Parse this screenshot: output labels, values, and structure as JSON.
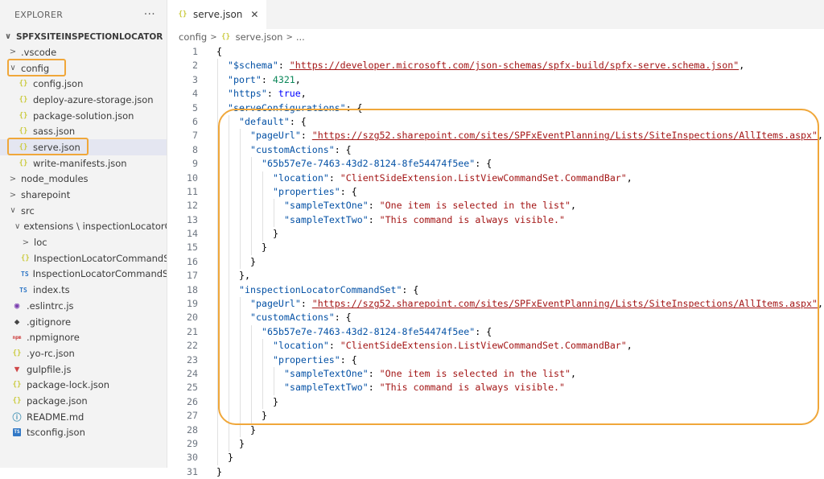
{
  "explorer": {
    "title": "EXPLORER",
    "more": "···",
    "root": "SPFXSITEINSPECTIONLOCATOR",
    "items": [
      {
        "label": ".vscode",
        "indent": 1,
        "chevron": ">",
        "icon": ""
      },
      {
        "label": "config",
        "indent": 1,
        "chevron": "∨",
        "icon": ""
      },
      {
        "label": "config.json",
        "indent": 2,
        "chevron": "",
        "icon": "{}"
      },
      {
        "label": "deploy-azure-storage.json",
        "indent": 2,
        "chevron": "",
        "icon": "{}"
      },
      {
        "label": "package-solution.json",
        "indent": 2,
        "chevron": "",
        "icon": "{}"
      },
      {
        "label": "sass.json",
        "indent": 2,
        "chevron": "",
        "icon": "{}"
      },
      {
        "label": "serve.json",
        "indent": 2,
        "chevron": "",
        "icon": "{}"
      },
      {
        "label": "write-manifests.json",
        "indent": 2,
        "chevron": "",
        "icon": "{}"
      },
      {
        "label": "node_modules",
        "indent": 1,
        "chevron": ">",
        "icon": ""
      },
      {
        "label": "sharepoint",
        "indent": 1,
        "chevron": ">",
        "icon": ""
      },
      {
        "label": "src",
        "indent": 1,
        "chevron": "∨",
        "icon": ""
      },
      {
        "label": "extensions \\ inspectionLocatorC...",
        "indent": 2,
        "chevron": "∨",
        "icon": ""
      },
      {
        "label": "loc",
        "indent": 3,
        "chevron": ">",
        "icon": ""
      },
      {
        "label": "InspectionLocatorCommandS...",
        "indent": 3,
        "chevron": "",
        "icon": "{}"
      },
      {
        "label": "InspectionLocatorCommandS...",
        "indent": 3,
        "chevron": "",
        "icon": "TS"
      },
      {
        "label": "index.ts",
        "indent": 2,
        "chevron": "",
        "icon": "TS"
      },
      {
        "label": ".eslintrc.js",
        "indent": 1,
        "chevron": "",
        "icon": "◉"
      },
      {
        "label": ".gitignore",
        "indent": 1,
        "chevron": "",
        "icon": "◆"
      },
      {
        "label": ".npmignore",
        "indent": 1,
        "chevron": "",
        "icon": "npm"
      },
      {
        "label": ".yo-rc.json",
        "indent": 1,
        "chevron": "",
        "icon": "{}"
      },
      {
        "label": "gulpfile.js",
        "indent": 1,
        "chevron": "",
        "icon": "▼"
      },
      {
        "label": "package-lock.json",
        "indent": 1,
        "chevron": "",
        "icon": "{}"
      },
      {
        "label": "package.json",
        "indent": 1,
        "chevron": "",
        "icon": "{}"
      },
      {
        "label": "README.md",
        "indent": 1,
        "chevron": "",
        "icon": "ⓘ"
      },
      {
        "label": "tsconfig.json",
        "indent": 1,
        "chevron": "",
        "icon": "TS"
      }
    ]
  },
  "tab": {
    "icon": "{}",
    "label": "serve.json",
    "close": "✕"
  },
  "breadcrumbs": {
    "folder": "config",
    "sep1": ">",
    "icon": "{}",
    "file": "serve.json",
    "sep2": ">",
    "more": "..."
  },
  "code_lines": [
    {
      "n": "1",
      "indent": 0,
      "tokens": [
        [
          "p",
          "{"
        ]
      ]
    },
    {
      "n": "2",
      "indent": 1,
      "tokens": [
        [
          "k",
          "\"$schema\""
        ],
        [
          "p",
          ": "
        ],
        [
          "u",
          "\"https://developer.microsoft.com/json-schemas/spfx-build/spfx-serve.schema.json\""
        ],
        [
          "p",
          ","
        ]
      ]
    },
    {
      "n": "3",
      "indent": 1,
      "tokens": [
        [
          "k",
          "\"port\""
        ],
        [
          "p",
          ": "
        ],
        [
          "n",
          "4321"
        ],
        [
          "p",
          ","
        ]
      ]
    },
    {
      "n": "4",
      "indent": 1,
      "tokens": [
        [
          "k",
          "\"https\""
        ],
        [
          "p",
          ": "
        ],
        [
          "b",
          "true"
        ],
        [
          "p",
          ","
        ]
      ]
    },
    {
      "n": "5",
      "indent": 1,
      "tokens": [
        [
          "k",
          "\"serveConfigurations\""
        ],
        [
          "p",
          ": {"
        ]
      ]
    },
    {
      "n": "6",
      "indent": 2,
      "tokens": [
        [
          "k",
          "\"default\""
        ],
        [
          "p",
          ": {"
        ]
      ]
    },
    {
      "n": "7",
      "indent": 3,
      "tokens": [
        [
          "k",
          "\"pageUrl\""
        ],
        [
          "p",
          ": "
        ],
        [
          "u",
          "\"https://szg52.sharepoint.com/sites/SPFxEventPlanning/Lists/SiteInspections/AllItems.aspx\""
        ],
        [
          "p",
          ","
        ]
      ]
    },
    {
      "n": "8",
      "indent": 3,
      "tokens": [
        [
          "k",
          "\"customActions\""
        ],
        [
          "p",
          ": {"
        ]
      ]
    },
    {
      "n": "9",
      "indent": 4,
      "tokens": [
        [
          "k",
          "\"65b57e7e-7463-43d2-8124-8fe54474f5ee\""
        ],
        [
          "p",
          ": {"
        ]
      ]
    },
    {
      "n": "10",
      "indent": 5,
      "tokens": [
        [
          "k",
          "\"location\""
        ],
        [
          "p",
          ": "
        ],
        [
          "s",
          "\"ClientSideExtension.ListViewCommandSet.CommandBar\""
        ],
        [
          "p",
          ","
        ]
      ]
    },
    {
      "n": "11",
      "indent": 5,
      "tokens": [
        [
          "k",
          "\"properties\""
        ],
        [
          "p",
          ": {"
        ]
      ]
    },
    {
      "n": "12",
      "indent": 6,
      "tokens": [
        [
          "k",
          "\"sampleTextOne\""
        ],
        [
          "p",
          ": "
        ],
        [
          "s",
          "\"One item is selected in the list\""
        ],
        [
          "p",
          ","
        ]
      ]
    },
    {
      "n": "13",
      "indent": 6,
      "tokens": [
        [
          "k",
          "\"sampleTextTwo\""
        ],
        [
          "p",
          ": "
        ],
        [
          "s",
          "\"This command is always visible.\""
        ]
      ]
    },
    {
      "n": "14",
      "indent": 5,
      "tokens": [
        [
          "p",
          "}"
        ]
      ]
    },
    {
      "n": "15",
      "indent": 4,
      "tokens": [
        [
          "p",
          "}"
        ]
      ]
    },
    {
      "n": "16",
      "indent": 3,
      "tokens": [
        [
          "p",
          "}"
        ]
      ]
    },
    {
      "n": "17",
      "indent": 2,
      "tokens": [
        [
          "p",
          "},"
        ]
      ]
    },
    {
      "n": "18",
      "indent": 2,
      "tokens": [
        [
          "k",
          "\"inspectionLocatorCommandSet\""
        ],
        [
          "p",
          ": {"
        ]
      ]
    },
    {
      "n": "19",
      "indent": 3,
      "tokens": [
        [
          "k",
          "\"pageUrl\""
        ],
        [
          "p",
          ": "
        ],
        [
          "u",
          "\"https://szg52.sharepoint.com/sites/SPFxEventPlanning/Lists/SiteInspections/AllItems.aspx\""
        ],
        [
          "p",
          ","
        ]
      ]
    },
    {
      "n": "20",
      "indent": 3,
      "tokens": [
        [
          "k",
          "\"customActions\""
        ],
        [
          "p",
          ": {"
        ]
      ]
    },
    {
      "n": "21",
      "indent": 4,
      "tokens": [
        [
          "k",
          "\"65b57e7e-7463-43d2-8124-8fe54474f5ee\""
        ],
        [
          "p",
          ": {"
        ]
      ]
    },
    {
      "n": "22",
      "indent": 5,
      "tokens": [
        [
          "k",
          "\"location\""
        ],
        [
          "p",
          ": "
        ],
        [
          "s",
          "\"ClientSideExtension.ListViewCommandSet.CommandBar\""
        ],
        [
          "p",
          ","
        ]
      ]
    },
    {
      "n": "23",
      "indent": 5,
      "tokens": [
        [
          "k",
          "\"properties\""
        ],
        [
          "p",
          ": {"
        ]
      ]
    },
    {
      "n": "24",
      "indent": 6,
      "tokens": [
        [
          "k",
          "\"sampleTextOne\""
        ],
        [
          "p",
          ": "
        ],
        [
          "s",
          "\"One item is selected in the list\""
        ],
        [
          "p",
          ","
        ]
      ]
    },
    {
      "n": "25",
      "indent": 6,
      "tokens": [
        [
          "k",
          "\"sampleTextTwo\""
        ],
        [
          "p",
          ": "
        ],
        [
          "s",
          "\"This command is always visible.\""
        ]
      ]
    },
    {
      "n": "26",
      "indent": 5,
      "tokens": [
        [
          "p",
          "}"
        ]
      ]
    },
    {
      "n": "27",
      "indent": 4,
      "tokens": [
        [
          "p",
          "}"
        ]
      ]
    },
    {
      "n": "28",
      "indent": 3,
      "tokens": [
        [
          "p",
          "}"
        ]
      ]
    },
    {
      "n": "29",
      "indent": 2,
      "tokens": [
        [
          "p",
          "}"
        ]
      ]
    },
    {
      "n": "30",
      "indent": 1,
      "tokens": [
        [
          "p",
          "}"
        ]
      ]
    },
    {
      "n": "31",
      "indent": 0,
      "tokens": [
        [
          "p",
          "}"
        ]
      ]
    }
  ],
  "colors": {
    "highlight": "#f0a73a",
    "selection": "#e4e6f1",
    "key": "#0451a5",
    "string": "#a31515",
    "number": "#098658",
    "keyword": "#0000ff"
  }
}
